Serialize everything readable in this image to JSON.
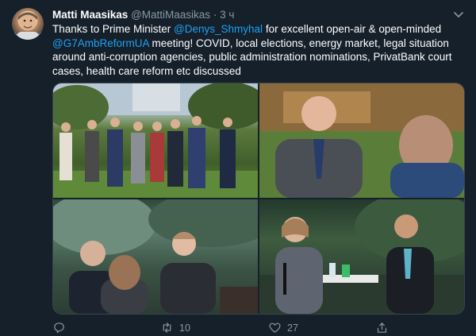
{
  "author": {
    "name": "Matti Maasikas",
    "handle": "@MattiMaasikas",
    "separator": "·",
    "time": "3 ч"
  },
  "tweet": {
    "text_1": "Thanks to Prime Minister ",
    "mention_1": "@Denys_Shmyhal",
    "text_2": " for excellent open-air & open-minded ",
    "mention_2": "@G7AmbReformUA",
    "text_3": " meeting! COVID, local elections, energy market, legal situation around anti-corruption agencies, public administration nominations, PrivatBank court cases, health care reform etc discussed"
  },
  "actions": {
    "retweets": "10",
    "likes": "27"
  },
  "icons": [
    "chevron-down-icon",
    "reply-icon",
    "retweet-icon",
    "like-icon",
    "share-icon"
  ],
  "colors": {
    "background": "#15202b",
    "link": "#1da1f2",
    "muted": "#8899a6"
  }
}
